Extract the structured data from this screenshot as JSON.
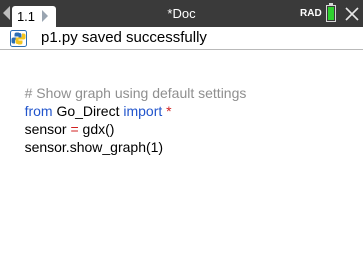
{
  "titlebar": {
    "tab_label": "1.1",
    "doc_title": "*Doc",
    "angle_mode": "RAD",
    "battery_level": 1.0,
    "battery_color": "#2fd12f"
  },
  "status": {
    "message": "p1.py saved successfully",
    "icon": "python-icon"
  },
  "editor": {
    "lines": [
      {
        "comment": "# Show graph using default settings"
      },
      {
        "kw_from": "from",
        "module": " Go_Direct ",
        "kw_import": "import",
        "star": " *"
      },
      {
        "left": "sensor ",
        "eq": "=",
        "right": " gdx()"
      },
      {
        "text": "sensor.show_graph(1)"
      }
    ]
  },
  "colors": {
    "keyword": "#2255cc",
    "comment": "#8f8f8f",
    "operator": "#d02020"
  }
}
